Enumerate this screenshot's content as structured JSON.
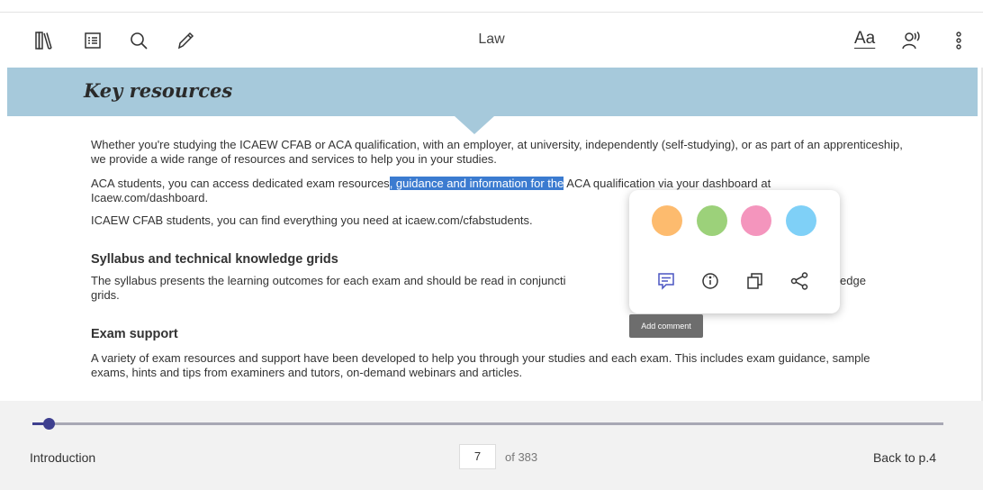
{
  "toolbar": {
    "title": "Law",
    "font_settings_label": "Aa",
    "icons": [
      "library-icon",
      "contents-icon",
      "search-icon",
      "pencil-icon",
      "read-aloud-icon",
      "more-icon"
    ]
  },
  "banner": {
    "title": "Key resources",
    "color": "#a6c9db"
  },
  "paragraphs": {
    "p1": "Whether you're studying the ICAEW CFAB or ACA qualification, with an employer, at university, independently (self-studying), or as part of an apprenticeship, we provide a wide range of resources and services to help you in your studies.",
    "p2_before": "ACA students, you can access dedicated exam resources",
    "p2_highlight": ", guidance and information for the",
    "p2_after": " ACA qualification via your dashboard at",
    "p2_line2": "Icaew.com/dashboard.",
    "p3": "ICAEW CFAB students, you can find everything you need at icaew.com/cfabstudents."
  },
  "sections": [
    {
      "heading": "Syllabus and technical knowledge grids",
      "text_left": "The syllabus presents the learning outcomes for each exam and should be read in conjuncti",
      "text_right": "edge",
      "text_line2": "grids."
    },
    {
      "heading": "Exam support",
      "text": "A variety of exam resources and support have been developed to help you through your studies and each exam. This includes exam guidance, sample exams, hints and tips from examiners and tutors, on-demand webinars and articles."
    }
  ],
  "highlight_popup": {
    "colors": [
      {
        "name": "orange",
        "hex": "#fdbb6e"
      },
      {
        "name": "green",
        "hex": "#9cd17a"
      },
      {
        "name": "pink",
        "hex": "#f495bd"
      },
      {
        "name": "blue",
        "hex": "#7fd0f7"
      }
    ],
    "actions": [
      "comment-icon",
      "dictionary-icon",
      "copy-icon",
      "share-icon"
    ],
    "tooltip": "Add comment"
  },
  "footer": {
    "chapter": "Introduction",
    "current_page": "7",
    "total_pages": "of 383",
    "back_link": "Back to p.4",
    "progress": 0.018,
    "accent": "#3e3f8f"
  }
}
